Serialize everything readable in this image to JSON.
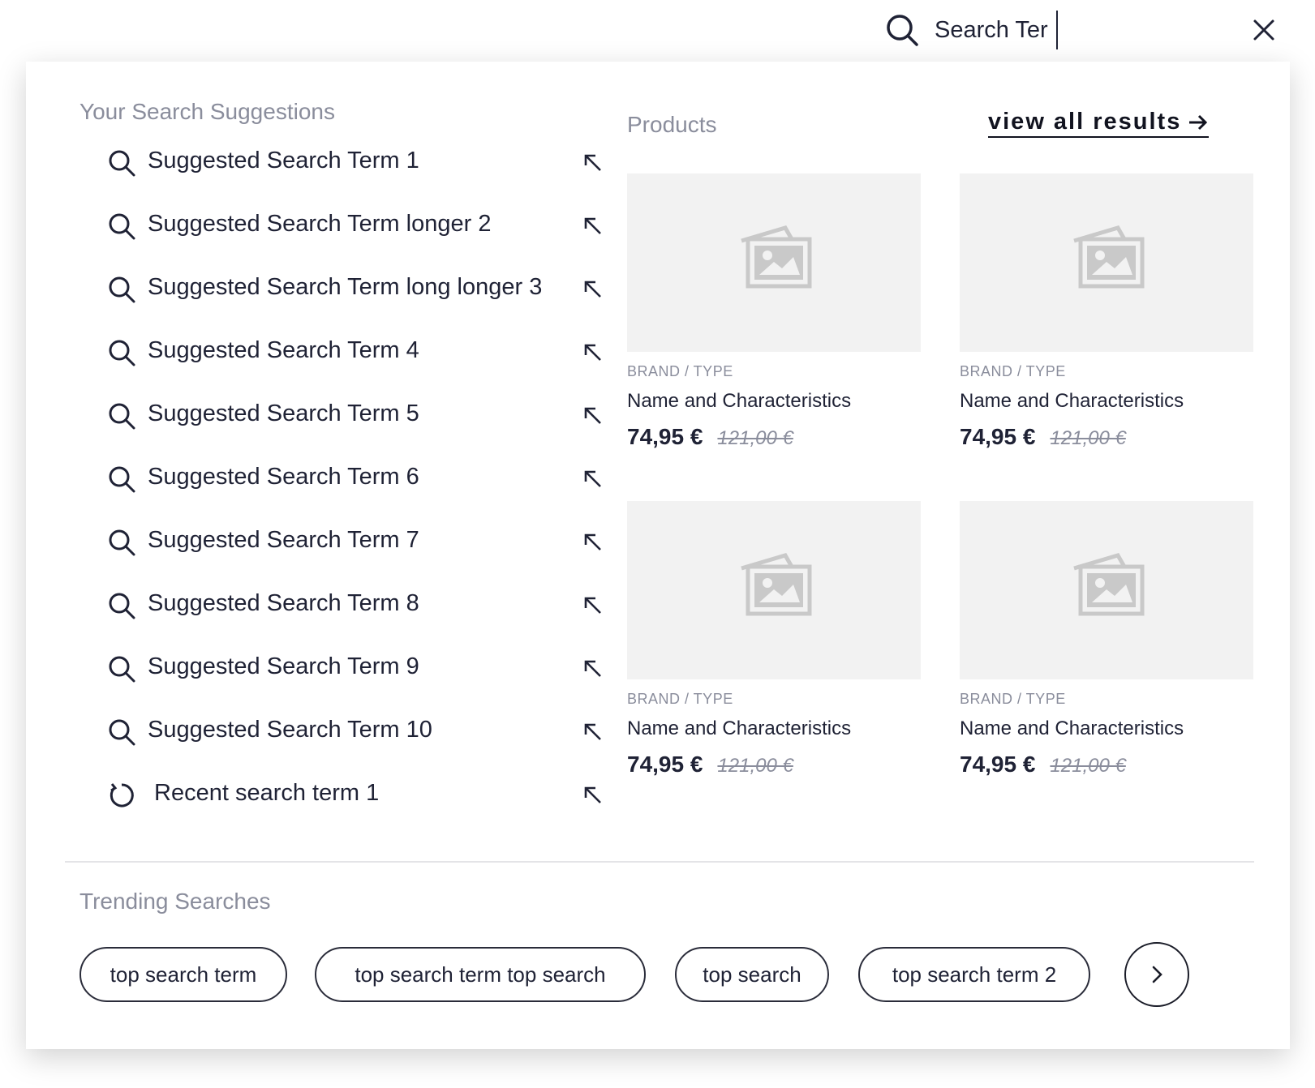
{
  "search": {
    "value": "Search Ter",
    "icon": "search-icon",
    "close_icon": "close-icon"
  },
  "suggestions": {
    "title": "Your Search Suggestions",
    "items": [
      {
        "label": "Suggested Search Term 1",
        "type": "suggestion"
      },
      {
        "label": "Suggested Search Term longer 2",
        "type": "suggestion"
      },
      {
        "label": "Suggested Search Term long longer 3",
        "type": "suggestion"
      },
      {
        "label": "Suggested Search Term 4",
        "type": "suggestion"
      },
      {
        "label": "Suggested Search Term 5",
        "type": "suggestion"
      },
      {
        "label": "Suggested Search Term 6",
        "type": "suggestion"
      },
      {
        "label": "Suggested Search Term 7",
        "type": "suggestion"
      },
      {
        "label": "Suggested Search Term 8",
        "type": "suggestion"
      },
      {
        "label": "Suggested Search Term 9",
        "type": "suggestion"
      },
      {
        "label": "Suggested Search Term 10",
        "type": "suggestion"
      },
      {
        "label": "Recent search term 1",
        "type": "recent"
      }
    ]
  },
  "products": {
    "title": "Products",
    "view_all": "view all results",
    "items": [
      {
        "brand": "BRAND / TYPE",
        "name": "Name and Characteristics",
        "price": "74,95 €",
        "old_price": "121,00 €"
      },
      {
        "brand": "BRAND / TYPE",
        "name": "Name and Characteristics",
        "price": "74,95 €",
        "old_price": "121,00 €"
      },
      {
        "brand": "BRAND / TYPE",
        "name": "Name and Characteristics",
        "price": "74,95 €",
        "old_price": "121,00 €"
      },
      {
        "brand": "BRAND / TYPE",
        "name": "Name and Characteristics",
        "price": "74,95 €",
        "old_price": "121,00 €"
      }
    ]
  },
  "trending": {
    "title": "Trending Searches",
    "chips": [
      "top search term",
      "top search term top search",
      "top search",
      "top search term 2"
    ]
  },
  "colors": {
    "text": "#1f2235",
    "muted": "#8a8d9c",
    "placeholder_bg": "#f2f2f2",
    "divider": "#e4e4e7"
  }
}
